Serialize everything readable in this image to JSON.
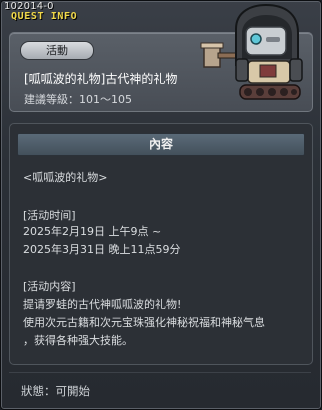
{
  "header": {
    "quest_id": "102014-0",
    "panel_title": "QUEST INFO"
  },
  "quest": {
    "type_label": "活動",
    "title": "[呱呱波的礼物]古代神的礼物",
    "level_line": "建議等級：101～105"
  },
  "content": {
    "header_label": "內容",
    "lines": [
      "<呱呱波的礼物>",
      "[活动时间]",
      "2025年2月19日 上午9点 ~",
      "2025年3月31日 晚上11点59分",
      "[活动内容]",
      "提请罗蛙的古代神呱呱波的礼物!",
      "使用次元古籍和次元宝珠强化神秘祝福和神秘气息",
      "，获得各种强大技能。"
    ]
  },
  "footer": {
    "status": "狀態：可開始"
  },
  "icons": {
    "avatar": "hooded-robot-with-mallet-icon"
  }
}
